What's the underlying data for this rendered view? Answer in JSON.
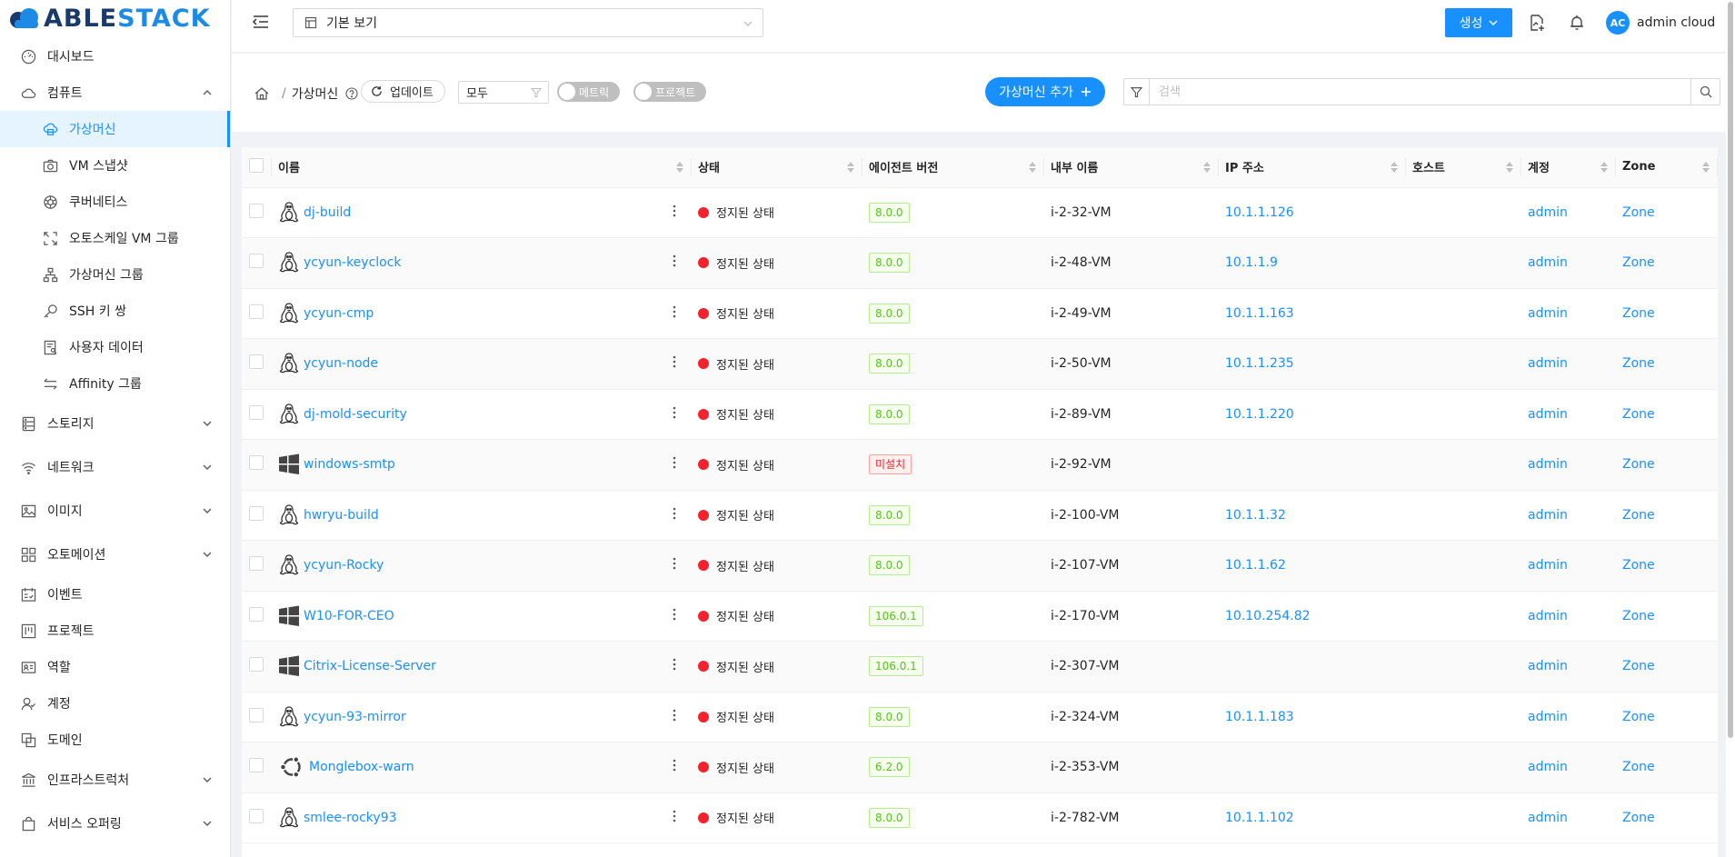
{
  "brand": {
    "part1": "ABLE",
    "part2": "STACK"
  },
  "sidebar": {
    "items": [
      {
        "label": "대시보드",
        "icon": "dashboard-icon",
        "level": "top"
      },
      {
        "label": "컴퓨트",
        "icon": "cloud-icon",
        "level": "top",
        "expanded": true
      },
      {
        "label": "가상머신",
        "icon": "cloud-server-icon",
        "level": "sub",
        "active": true
      },
      {
        "label": "VM 스냅샷",
        "icon": "camera-icon",
        "level": "sub"
      },
      {
        "label": "쿠버네티스",
        "icon": "kubernetes-icon",
        "level": "sub"
      },
      {
        "label": "오토스케일 VM 그룹",
        "icon": "autoscale-icon",
        "level": "sub"
      },
      {
        "label": "가상머신 그룹",
        "icon": "cluster-icon",
        "level": "sub"
      },
      {
        "label": "SSH 키 쌍",
        "icon": "key-icon",
        "level": "sub"
      },
      {
        "label": "사용자 데이터",
        "icon": "solution-icon",
        "level": "sub"
      },
      {
        "label": "Affinity 그룹",
        "icon": "swap-icon",
        "level": "sub"
      },
      {
        "label": "스토리지",
        "icon": "database-icon",
        "level": "group"
      },
      {
        "label": "네트워크",
        "icon": "wifi-icon",
        "level": "group"
      },
      {
        "label": "이미지",
        "icon": "picture-icon",
        "level": "group"
      },
      {
        "label": "오토메이션",
        "icon": "appstore-icon",
        "level": "group"
      },
      {
        "label": "이벤트",
        "icon": "schedule-icon",
        "level": "top"
      },
      {
        "label": "프로젝트",
        "icon": "project-icon",
        "level": "top"
      },
      {
        "label": "역할",
        "icon": "idcard-icon",
        "level": "top"
      },
      {
        "label": "계정",
        "icon": "team-icon",
        "level": "top"
      },
      {
        "label": "도메인",
        "icon": "block-icon",
        "level": "top"
      },
      {
        "label": "인프라스트럭처",
        "icon": "bank-icon",
        "level": "group"
      },
      {
        "label": "서비스 오퍼링",
        "icon": "shopping-icon",
        "level": "group"
      }
    ]
  },
  "header": {
    "view_select": "기본 보기",
    "create_label": "생성",
    "user_initials": "AC",
    "user_name": "admin cloud"
  },
  "toolbar": {
    "breadcrumb_current": "가상머신",
    "breadcrumb_sep": "/",
    "refresh_label": "업데이트",
    "filter_value": "모두",
    "toggle_metrics": "메트릭",
    "toggle_project": "프로젝트",
    "add_label": "가상머신 추가",
    "search_placeholder": "검색"
  },
  "table": {
    "columns": [
      "이름",
      "상태",
      "에이전트 버전",
      "내부 이름",
      "IP 주소",
      "호스트",
      "계정",
      "Zone"
    ],
    "rows": [
      {
        "name": "dj-build",
        "os": "linux",
        "state": "정지된 상태",
        "agent": "8.0.0",
        "agent_ok": true,
        "internal": "i-2-32-VM",
        "ip": "10.1.1.126",
        "host": "",
        "account": "admin",
        "zone": "Zone"
      },
      {
        "name": "ycyun-keyclock",
        "os": "linux",
        "state": "정지된 상태",
        "agent": "8.0.0",
        "agent_ok": true,
        "internal": "i-2-48-VM",
        "ip": "10.1.1.9",
        "host": "",
        "account": "admin",
        "zone": "Zone"
      },
      {
        "name": "ycyun-cmp",
        "os": "linux",
        "state": "정지된 상태",
        "agent": "8.0.0",
        "agent_ok": true,
        "internal": "i-2-49-VM",
        "ip": "10.1.1.163",
        "host": "",
        "account": "admin",
        "zone": "Zone"
      },
      {
        "name": "ycyun-node",
        "os": "linux",
        "state": "정지된 상태",
        "agent": "8.0.0",
        "agent_ok": true,
        "internal": "i-2-50-VM",
        "ip": "10.1.1.235",
        "host": "",
        "account": "admin",
        "zone": "Zone"
      },
      {
        "name": "dj-mold-security",
        "os": "linux",
        "state": "정지된 상태",
        "agent": "8.0.0",
        "agent_ok": true,
        "internal": "i-2-89-VM",
        "ip": "10.1.1.220",
        "host": "",
        "account": "admin",
        "zone": "Zone"
      },
      {
        "name": "windows-smtp",
        "os": "windows",
        "state": "정지된 상태",
        "agent": "미설치",
        "agent_ok": false,
        "internal": "i-2-92-VM",
        "ip": "",
        "host": "",
        "account": "admin",
        "zone": "Zone"
      },
      {
        "name": "hwryu-build",
        "os": "linux",
        "state": "정지된 상태",
        "agent": "8.0.0",
        "agent_ok": true,
        "internal": "i-2-100-VM",
        "ip": "10.1.1.32",
        "host": "",
        "account": "admin",
        "zone": "Zone"
      },
      {
        "name": "ycyun-Rocky",
        "os": "linux",
        "state": "정지된 상태",
        "agent": "8.0.0",
        "agent_ok": true,
        "internal": "i-2-107-VM",
        "ip": "10.1.1.62",
        "host": "",
        "account": "admin",
        "zone": "Zone"
      },
      {
        "name": "W10-FOR-CEO",
        "os": "windows",
        "state": "정지된 상태",
        "agent": "106.0.1",
        "agent_ok": true,
        "internal": "i-2-170-VM",
        "ip": "10.10.254.82",
        "host": "",
        "account": "admin",
        "zone": "Zone"
      },
      {
        "name": "Citrix-License-Server",
        "os": "windows",
        "state": "정지된 상태",
        "agent": "106.0.1",
        "agent_ok": true,
        "internal": "i-2-307-VM",
        "ip": "",
        "host": "",
        "account": "admin",
        "zone": "Zone"
      },
      {
        "name": "ycyun-93-mirror",
        "os": "linux",
        "state": "정지된 상태",
        "agent": "8.0.0",
        "agent_ok": true,
        "internal": "i-2-324-VM",
        "ip": "10.1.1.183",
        "host": "",
        "account": "admin",
        "zone": "Zone"
      },
      {
        "name": "Monglebox-warn",
        "os": "ubuntu",
        "state": "정지된 상태",
        "agent": "6.2.0",
        "agent_ok": true,
        "internal": "i-2-353-VM",
        "ip": "",
        "host": "",
        "account": "admin",
        "zone": "Zone"
      },
      {
        "name": "smlee-rocky93",
        "os": "linux",
        "state": "정지된 상태",
        "agent": "8.0.0",
        "agent_ok": true,
        "internal": "i-2-782-VM",
        "ip": "10.1.1.102",
        "host": "",
        "account": "admin",
        "zone": "Zone"
      }
    ]
  },
  "colors": {
    "primary": "#1890ff",
    "stopped": "#f5222d",
    "brand_dark": "#1a3a6b"
  }
}
